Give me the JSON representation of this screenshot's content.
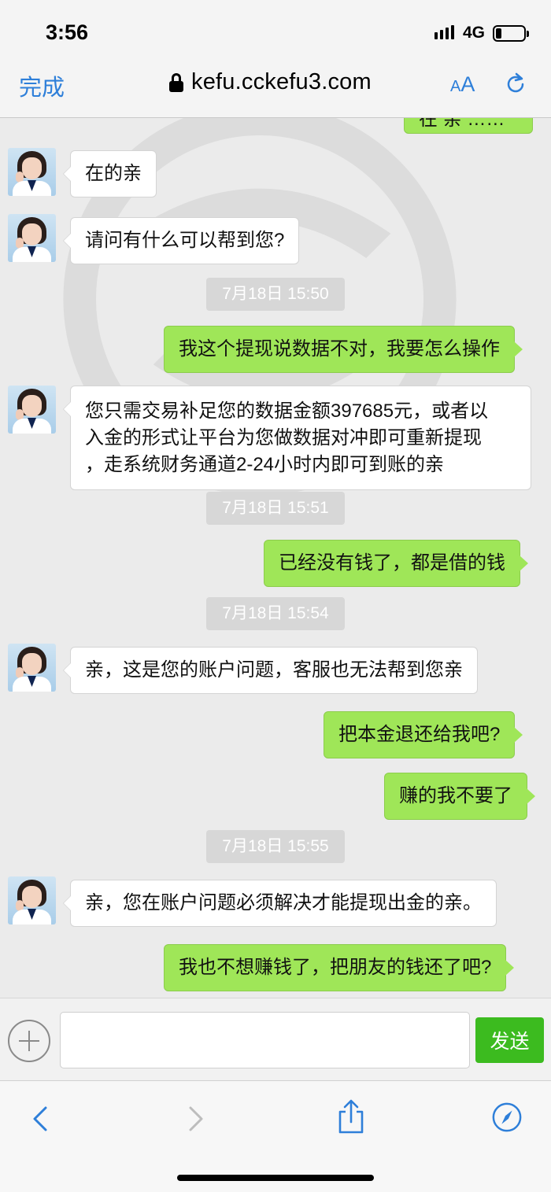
{
  "status": {
    "time": "3:56",
    "network": "4G",
    "battery_fraction": 0.2
  },
  "browser": {
    "done_label": "完成",
    "url": "kefu.cckefu3.com",
    "aa_small": "A",
    "aa_big": "A"
  },
  "chat": {
    "partial_top_text": "在 亲 ……",
    "messages": [
      {
        "from": "agent",
        "text": "在的亲"
      },
      {
        "from": "agent",
        "text": "请问有什么可以帮到您?"
      },
      {
        "type": "time",
        "text": "7月18日 15:50"
      },
      {
        "from": "user",
        "text": "我这个提现说数据不对，我要怎么操作"
      },
      {
        "from": "agent",
        "lines": [
          "您只需交易补足您的数据金额397685元，或者以",
          "入金的形式让平台为您做数据对冲即可重新提现",
          "，走系统财务通道2-24小时内即可到账的亲"
        ]
      },
      {
        "type": "time",
        "text": "7月18日 15:51"
      },
      {
        "from": "user",
        "text": "已经没有钱了，都是借的钱"
      },
      {
        "type": "time",
        "text": "7月18日 15:54"
      },
      {
        "from": "agent",
        "text": "亲，这是您的账户问题，客服也无法帮到您亲"
      },
      {
        "from": "user",
        "text": "把本金退还给我吧?"
      },
      {
        "from": "user",
        "text": "赚的我不要了"
      },
      {
        "type": "time",
        "text": "7月18日 15:55"
      },
      {
        "from": "agent",
        "text": "亲，您在账户问题必须解决才能提现出金的亲。"
      },
      {
        "from": "user",
        "text": "我也不想赚钱了，把朋友的钱还了吧?"
      }
    ]
  },
  "composer": {
    "input_value": "",
    "send_label": "发送"
  },
  "colors": {
    "accent": "#2e7fd9",
    "user_bubble": "#9fe658",
    "send_button": "#3cbb1f"
  },
  "icons": [
    "lock-icon",
    "reload-icon",
    "plus-icon",
    "back-icon",
    "forward-icon",
    "share-icon",
    "compass-icon"
  ]
}
